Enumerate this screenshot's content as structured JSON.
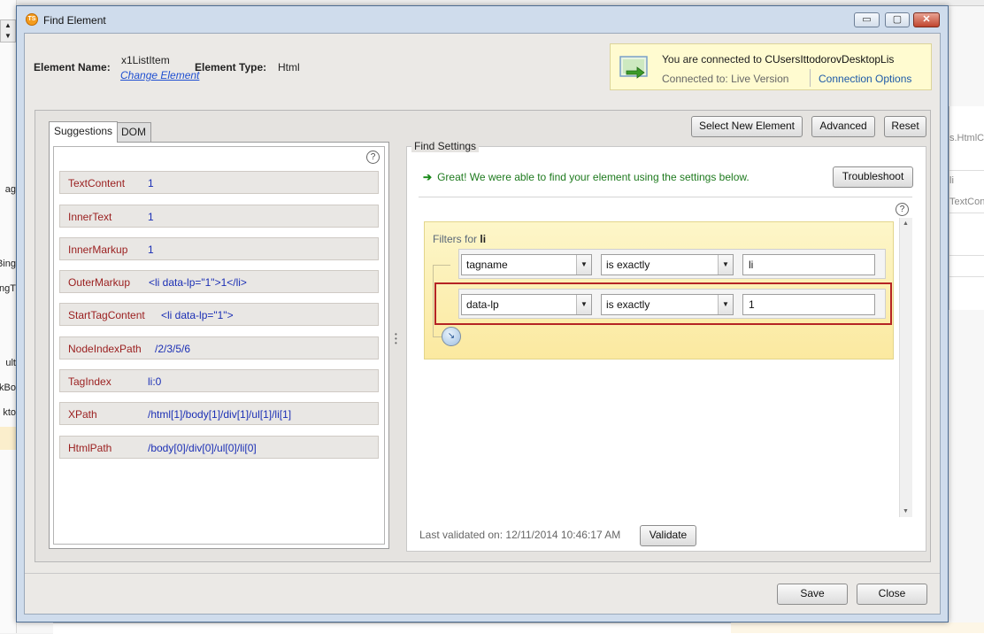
{
  "window": {
    "title": "Find Element",
    "icon_text": "TS",
    "controls": {
      "minimize": "▭",
      "maximize": "▢",
      "close": "✕"
    }
  },
  "header": {
    "element_name_label": "Element Name:",
    "element_name_value": "x1ListItem",
    "change_element_link": "Change Element",
    "element_type_label": "Element Type:",
    "element_type_value": "Html"
  },
  "connection": {
    "line1_prefix": "You are connected to",
    "target": "CUsersIttodorovDesktopLis",
    "connected_to_label": "Connected to:",
    "connected_to_value": "Live Version",
    "options_link": "Connection Options",
    "icon": "monitor-arrow-icon"
  },
  "tabs": [
    {
      "label": "Suggestions",
      "active": true
    },
    {
      "label": "DOM",
      "active": false
    }
  ],
  "suggestions": [
    {
      "key": "TextContent",
      "value": "1"
    },
    {
      "key": "InnerText",
      "value": "1"
    },
    {
      "key": "InnerMarkup",
      "value": "1"
    },
    {
      "key": "OuterMarkup",
      "value": "<li data-lp=\"1\">1</li>"
    },
    {
      "key": "StartTagContent",
      "value": "<li data-lp=\"1\">"
    },
    {
      "key": "NodeIndexPath",
      "value": "/2/3/5/6"
    },
    {
      "key": "TagIndex",
      "value": "li:0"
    },
    {
      "key": "XPath",
      "value": "/html[1]/body[1]/div[1]/ul[1]/li[1]"
    },
    {
      "key": "HtmlPath",
      "value": "/body[0]/div[0]/ul[0]/li[0]"
    }
  ],
  "toolbar": {
    "select_new_element": "Select New Element",
    "advanced": "Advanced",
    "reset": "Reset"
  },
  "find_settings": {
    "legend": "Find Settings",
    "message": "Great! We were able to find your element using the settings below.",
    "troubleshoot": "Troubleshoot",
    "filters_title_prefix": "Filters for",
    "filters_title_tag": "li",
    "filters": [
      {
        "attribute": "tagname",
        "operator": "is exactly",
        "value": "li",
        "selected": false
      },
      {
        "attribute": "data-lp",
        "operator": "is exactly",
        "value": "1",
        "selected": true
      }
    ],
    "last_validated_label": "Last validated on:",
    "last_validated_value": "12/11/2014 10:46:17 AM",
    "validate": "Validate"
  },
  "footer": {
    "save": "Save",
    "close": "Close"
  },
  "background": {
    "left_fragments": [
      "ag",
      "Bing",
      "ngT",
      "ult",
      "kBo",
      "kto"
    ],
    "right_fragments": [
      "s.HtmlC",
      "li",
      "TextCon"
    ]
  },
  "colors": {
    "accent_link": "#1f4fd1",
    "suggestion_key": "#9a1e1e",
    "suggestion_value": "#1b2fb5",
    "success": "#1e7a1e",
    "selected_filter_border": "#b52424",
    "connection_bg": "#fffbd0"
  }
}
